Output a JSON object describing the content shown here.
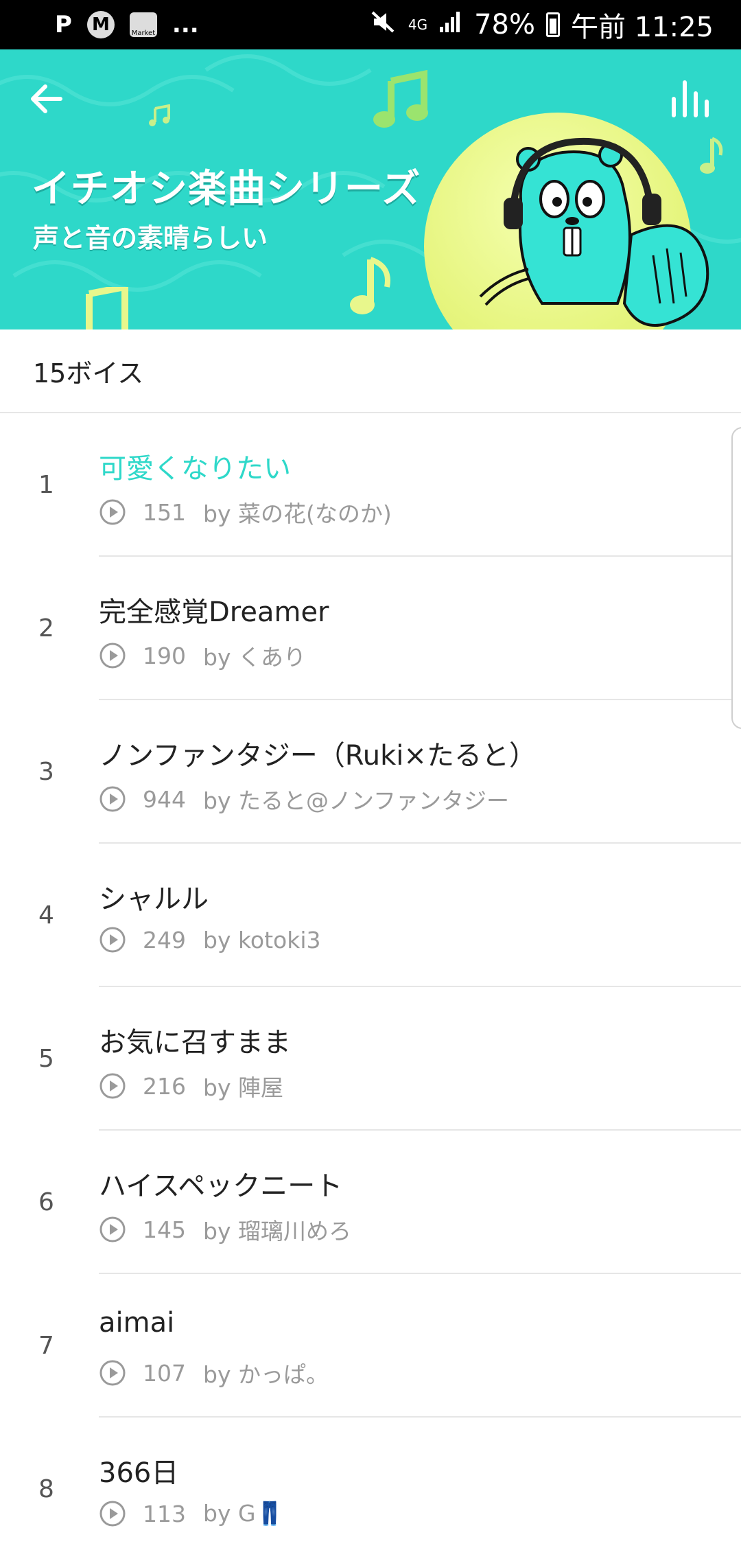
{
  "status_bar": {
    "p_icon": "P",
    "m_icon": "M",
    "market_label": "Market",
    "overflow": "...",
    "network": "4G",
    "battery": "78%",
    "time": "午前 11:25",
    "icons": [
      "mute-icon",
      "signal-icon",
      "battery-icon"
    ]
  },
  "banner": {
    "title": "イチオシ楽曲シリーズ",
    "subtitle": "声と音の素晴らしい",
    "back_icon": "arrow-left-icon",
    "equalizer_icon": "equalizer-icon",
    "colors": {
      "background": "#2ed8c9",
      "circle": "#e6f57e",
      "accent": "#2ed8c9"
    }
  },
  "list": {
    "count_label": "15ボイス",
    "items": [
      {
        "rank": "1",
        "title": "可愛くなりたい",
        "plays": "151",
        "author": "by 菜の花(なのか)",
        "active": true
      },
      {
        "rank": "2",
        "title": "完全感覚Dreamer",
        "plays": "190",
        "author": "by くあり"
      },
      {
        "rank": "3",
        "title": "ノンファンタジー（Ruki×たると）",
        "plays": "944",
        "author": "by たると@ノンファンタジー"
      },
      {
        "rank": "4",
        "title": "シャルル",
        "plays": "249",
        "author": "by kotoki3"
      },
      {
        "rank": "5",
        "title": "お気に召すまま",
        "plays": "216",
        "author": "by 陣屋"
      },
      {
        "rank": "6",
        "title": "ハイスペックニート",
        "plays": "145",
        "author": "by 瑠璃川めろ"
      },
      {
        "rank": "7",
        "title": "aimai",
        "plays": "107",
        "author": "by かっぱ。"
      },
      {
        "rank": "8",
        "title": "366日",
        "plays": "113",
        "author": "by G👖"
      }
    ]
  }
}
